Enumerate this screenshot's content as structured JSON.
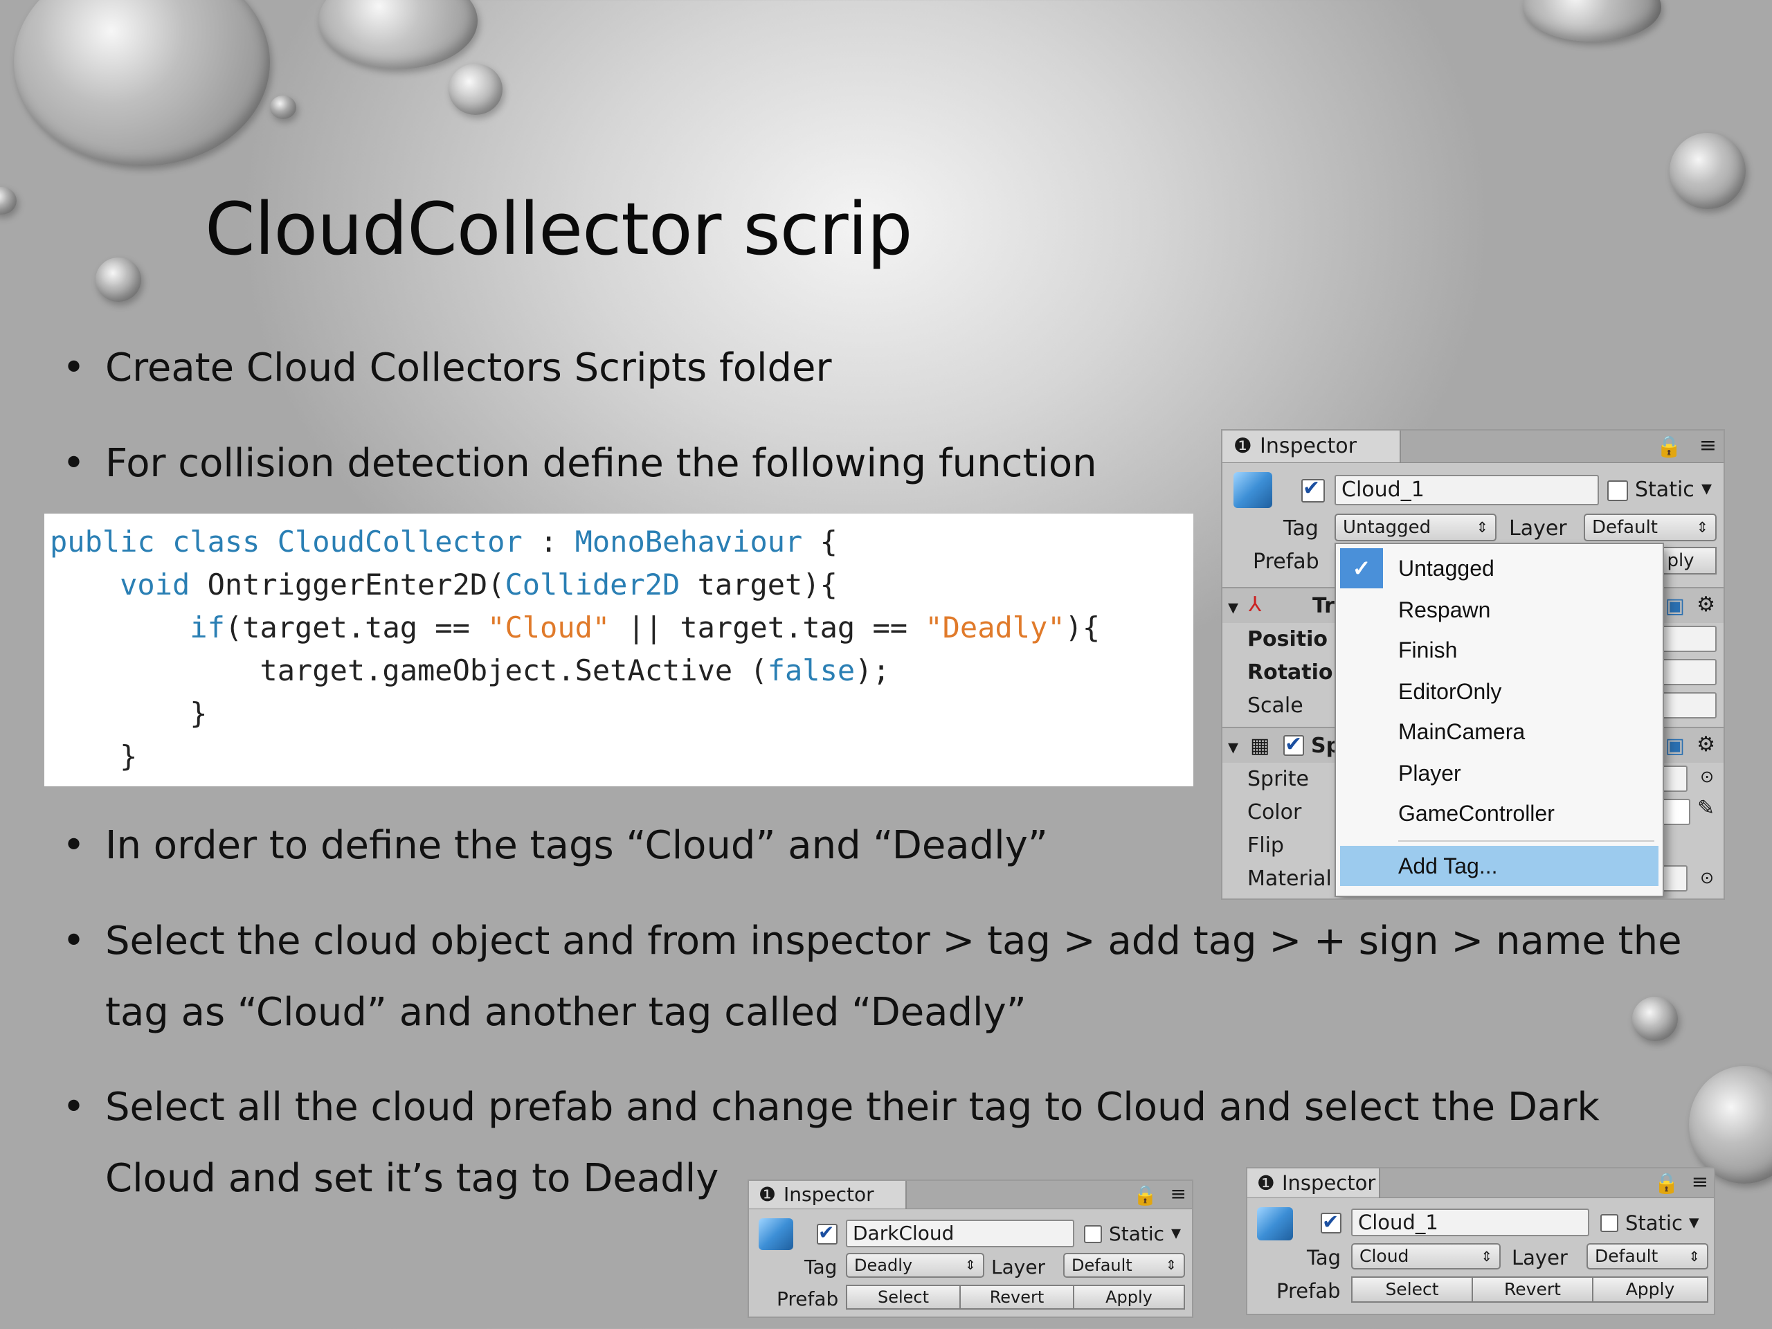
{
  "slide": {
    "title": "CloudCollector scrip",
    "bullets": [
      "Create Cloud Collectors Scripts folder",
      "For collision detection define the following function",
      "In order to define the tags “Cloud” and “Deadly”",
      "Select the cloud object and from inspector > tag > add tag > + sign >  name the tag as “Cloud” and another tag called “Deadly”",
      "Select all the cloud prefab and change their tag to Cloud and select the Dark Cloud and set it’s tag to Deadly"
    ],
    "bullet_symbol": "•"
  },
  "code": {
    "l1": {
      "a": "public class ",
      "b": "CloudCollector",
      "c": " : ",
      "d": "MonoBehaviour",
      "e": " {"
    },
    "l2": {
      "a": "    void ",
      "b": "OntriggerEnter2D(",
      "c": "Collider2D",
      "d": " target){"
    },
    "l3": {
      "a": "        if",
      "b": "(target.tag == ",
      "c": "\"Cloud\"",
      "d": " || target.tag == ",
      "e": "\"Deadly\"",
      "f": "){"
    },
    "l4": {
      "a": "            target.gameObject.SetActive (",
      "b": "false",
      "c": ");"
    },
    "l5": "        }",
    "l6": "    }"
  },
  "inspector_main": {
    "tab": "Inspector",
    "object_name": "Cloud_1",
    "static_label": "Static",
    "tag_label": "Tag",
    "tag_value": "Untagged",
    "layer_label": "Layer",
    "layer_value": "Default",
    "prefab_label": "Prefab",
    "apply_partial": "ply",
    "transform_header": "Tr",
    "position_label": "Positio",
    "rotation_label": "Rotatio",
    "scale_label": "Scale",
    "sprite_header": "Sp",
    "sprite_label": "Sprite",
    "color_label": "Color",
    "flip_label": "Flip",
    "material_label": "Material"
  },
  "tag_menu": {
    "items": [
      "Untagged",
      "Respawn",
      "Finish",
      "EditorOnly",
      "MainCamera",
      "Player",
      "GameController"
    ],
    "checked": "Untagged",
    "add_tag": "Add Tag..."
  },
  "inspector_dark": {
    "tab": "Inspector",
    "object_name": "DarkCloud",
    "static_label": "Static",
    "tag_label": "Tag",
    "tag_value": "Deadly",
    "layer_label": "Layer",
    "layer_value": "Default",
    "prefab_label": "Prefab",
    "select": "Select",
    "revert": "Revert",
    "apply": "Apply"
  },
  "inspector_cloud": {
    "tab": "Inspector",
    "object_name": "Cloud_1",
    "static_label": "Static",
    "tag_label": "Tag",
    "tag_value": "Cloud",
    "layer_label": "Layer",
    "layer_value": "Default",
    "prefab_label": "Prefab",
    "select": "Select",
    "revert": "Revert",
    "apply": "Apply"
  },
  "colors": {
    "accent": "#2a7fb4",
    "string": "#e07a2a",
    "menu_highlight": "#9ccbee",
    "check_bg": "#4a90d9"
  }
}
